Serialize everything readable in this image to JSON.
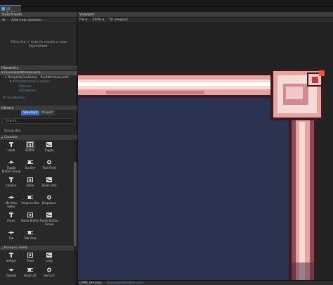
{
  "window": {
    "tab_label": "UI Builder"
  },
  "stylesheets": {
    "header": "StyleSheets",
    "add_placeholder": "Add new selector...",
    "hint": "Click the + icon to create a new StyleSheet."
  },
  "hierarchy": {
    "header": "Hierarchy",
    "rows": [
      "CloseableWindow.uxml",
      "TemplateContainer  ·  RootWindow.uxml",
      "#RootWindowContainer",
      "#Border",
      "#DragArea",
      "#CloseButton"
    ]
  },
  "library": {
    "header": "Library",
    "tabs": [
      "Standard",
      "Project"
    ],
    "search_placeholder": "Search...",
    "group_label": "Group Box",
    "categories": [
      "Controls",
      "Numeric Fields"
    ],
    "controls": [
      {
        "label": "Label",
        "icon": "label-icon"
      },
      {
        "label": "Button",
        "icon": "button-icon"
      },
      {
        "label": "Toggle",
        "icon": "toggle-icon"
      },
      {
        "label": "Toggle\nButton Group",
        "icon": "toggle-button-group-icon"
      },
      {
        "label": "Scroller",
        "icon": "scroller-icon"
      },
      {
        "label": "Text Field",
        "icon": "text-field-icon"
      },
      {
        "label": "Foldout",
        "icon": "foldout-icon"
      },
      {
        "label": "Slider",
        "icon": "slider-icon"
      },
      {
        "label": "Slider (Int)",
        "icon": "slider-int-icon"
      },
      {
        "label": "Min-Max\nSlider",
        "icon": "min-max-slider-icon"
      },
      {
        "label": "Progress Bar",
        "icon": "progress-bar-icon"
      },
      {
        "label": "Dropdown",
        "icon": "dropdown-icon"
      },
      {
        "label": "Enum",
        "icon": "enum-icon"
      },
      {
        "label": "Radio Button",
        "icon": "radio-button-icon"
      },
      {
        "label": "Radio Button\nGroup",
        "icon": "radio-button-group-icon"
      },
      {
        "label": "Tab",
        "icon": "tab-icon"
      },
      {
        "label": "Tab View",
        "icon": "tab-view-icon"
      }
    ],
    "numeric": [
      {
        "label": "Integer",
        "icon": "integer-icon"
      },
      {
        "label": "Float",
        "icon": "float-icon"
      },
      {
        "label": "Long",
        "icon": "long-icon"
      },
      {
        "label": "Double",
        "icon": "double-icon"
      },
      {
        "label": "Hash128",
        "icon": "hash128-icon"
      },
      {
        "label": "Vector2",
        "icon": "vector2-icon"
      }
    ]
  },
  "viewport": {
    "header": "Viewport",
    "file_menu": "File ▾",
    "zoom": "400% ▾",
    "fit": "Fit viewport"
  },
  "uxml_bar": {
    "label": "UXML Preview",
    "file": "CloseableWindow.uxml"
  },
  "colors": {
    "accent": "#3d6ebf",
    "window_bg": "#2a3250",
    "border_light": "#f7d9d6",
    "border_mid": "#e8a4a0",
    "border_dark": "#3a1a20",
    "close_red": "#c23a3a"
  }
}
